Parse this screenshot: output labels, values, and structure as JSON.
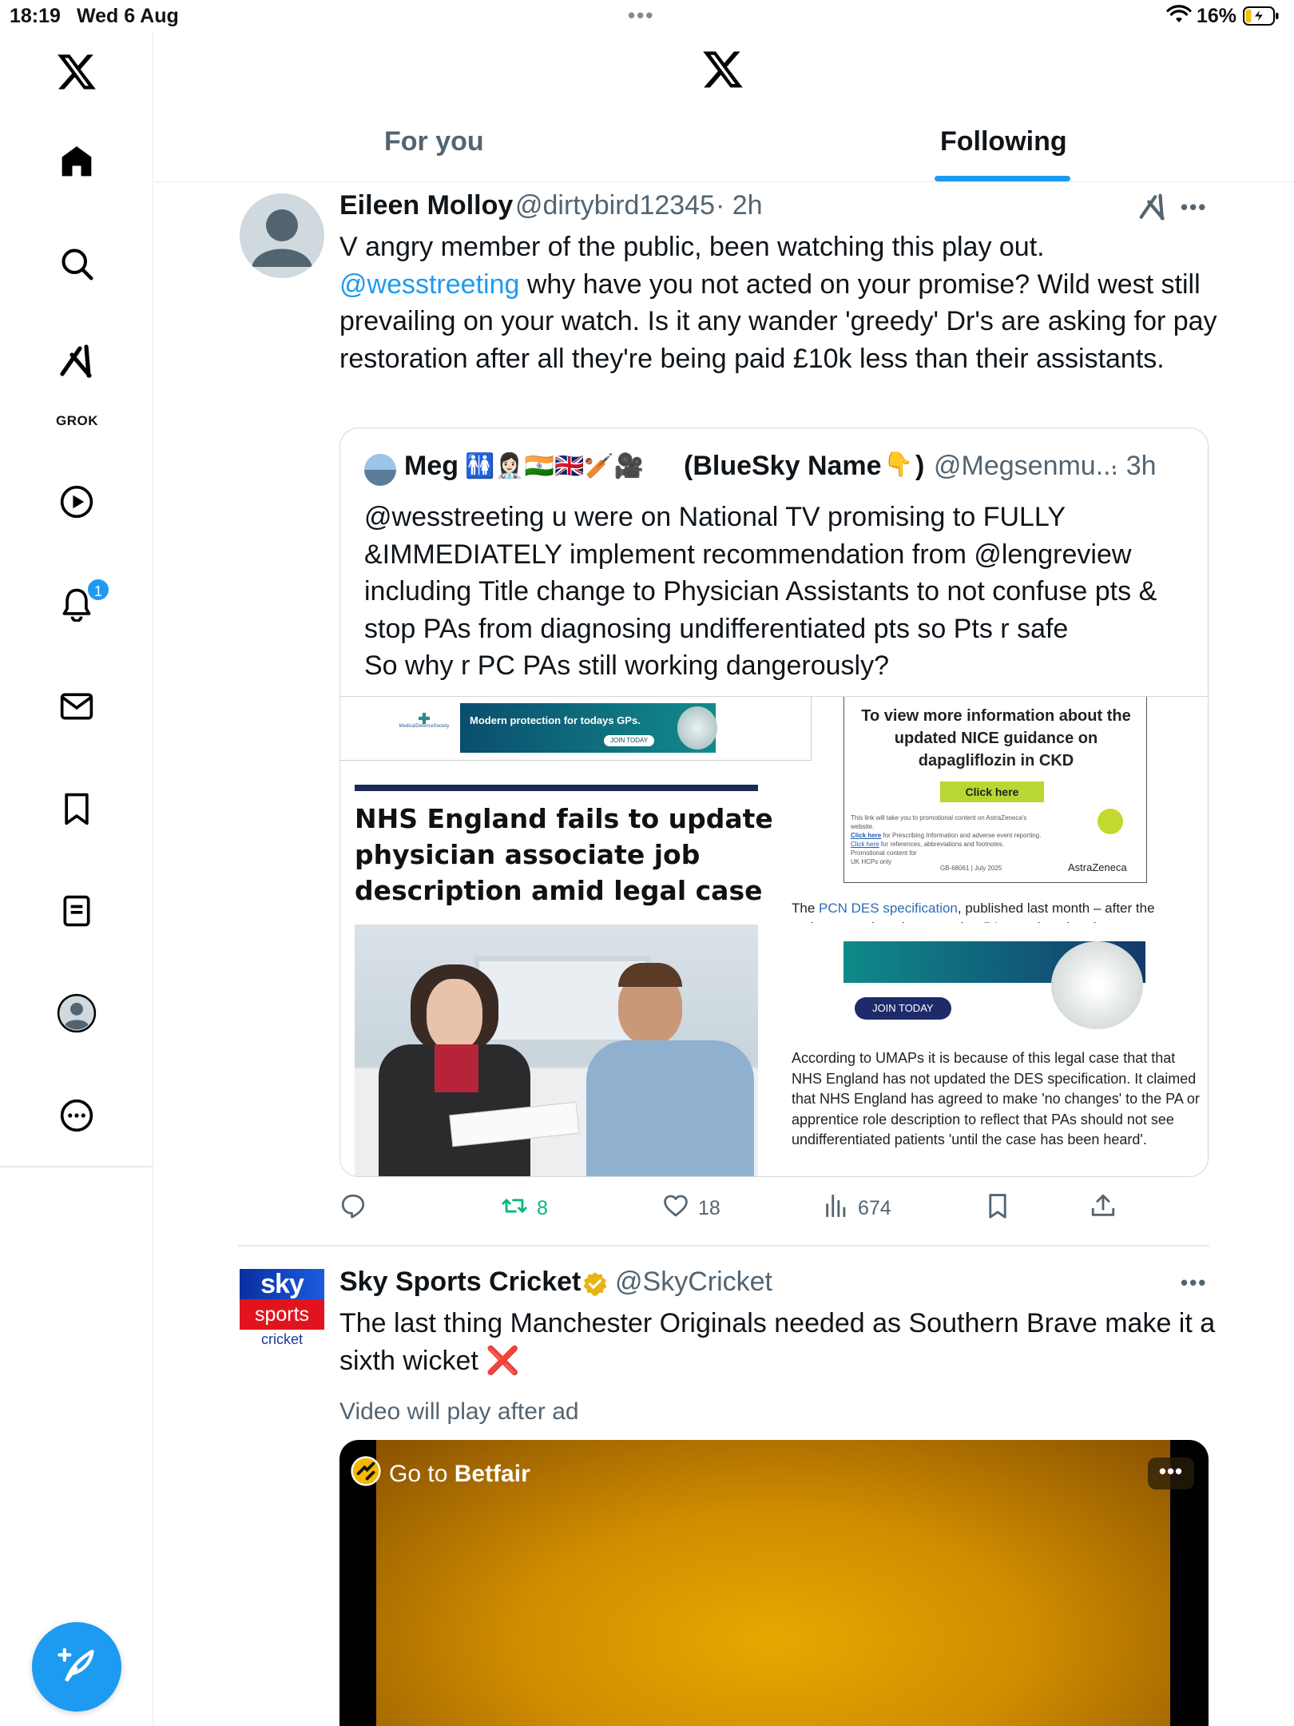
{
  "status_bar": {
    "time": "18:19",
    "date": "Wed 6 Aug",
    "battery": "16%"
  },
  "sidebar": {
    "grok_label": "GROK",
    "notification_count": "1"
  },
  "header": {
    "tabs": [
      {
        "label": "For you",
        "active": false
      },
      {
        "label": "Following",
        "active": true
      }
    ]
  },
  "tweet1": {
    "name": "Eileen Molloy",
    "handle": "@dirtybird12345",
    "time": "· 2h",
    "text_line1": "V angry member of the public, been watching this play out.",
    "mention": "@wesstreeting",
    "text_rest": " why have you not acted on your promise? Wild west still prevailing on your watch. Is it any wander 'greedy' Dr's are asking for pay restoration after all they're being paid £10k less than their assistants.",
    "quote": {
      "name": "Meg",
      "emojis": "🚻👩🏻‍⚕️🇮🇳🇬🇧🏏🎥",
      "name_suffix": "(BlueSky Name",
      "name_end": ")",
      "handle": "@Megsenmu...",
      "time": "· 3h",
      "text": "@wesstreeting u were on National TV promising to FULLY &IMMEDIATELY implement recommendation from @lengreview including Title change to Physician Assistants to not confuse pts & stop PAs from diagnosing undifferentiated pts so Pts r safe\nSo why r PC PAs still working dangerously?",
      "image": {
        "ad_banner_text": "Modern protection for todays GPs.",
        "ad_banner_btn": "JOIN TODAY",
        "ad_logo": "MedicalDefenceSociety",
        "headline": "NHS England fails to update physician associate job description amid legal case",
        "az_title": "To view more information about the updated NICE guidance on dapagliflozin in CKD",
        "az_btn": "Click here",
        "az_fine1": "This link will take you to promotional content on AstraZeneca's website.",
        "az_fine2_link": "Click here",
        "az_fine2": " for Prescribing Information and adverse event reporting.",
        "az_fine3_link": "Click here",
        "az_fine3": " for references, abbreviations and footnotes.",
        "az_fine4": "Promotional content for UK HCPs only",
        "az_code": "GB-68061 | July 2025",
        "az_brand": "AstraZeneca",
        "article_p1_pre": "The ",
        "article_p1_link": "PCN DES specification",
        "article_p1_post": ", published last month – after the review – continued to state that PAs employed under",
        "join_btn": "JOIN TODAY",
        "article_p2": "According to UMAPs it is because of this legal case that that NHS England has not updated the DES specification. It claimed that NHS England has agreed to make 'no changes' to the PA or apprentice role description to reflect that PAs should not see undifferentiated patients 'until the case has been heard'."
      }
    },
    "actions": {
      "reposts": "8",
      "likes": "18",
      "views": "674"
    }
  },
  "tweet2": {
    "name": "Sky Sports Cricket",
    "handle": "@SkyCricket",
    "text": "The last thing Manchester Originals needed as Southern Brave make it a sixth wicket ❌",
    "avatar_line1": "sky",
    "avatar_line2": "sports",
    "avatar_line3": "cricket",
    "video_note": "Video will play after ad",
    "video_cta_pre": "Go to ",
    "video_cta_brand": "Betfair",
    "video_more": "•••"
  },
  "colors": {
    "accent": "#1d9bf0",
    "text": "#0f1419",
    "muted": "#536471",
    "repost": "#00ba7c"
  },
  "icons": [
    "x-logo-icon",
    "home-icon",
    "search-icon",
    "grok-icon",
    "video-icon",
    "bell-icon",
    "mail-icon",
    "bookmark-icon",
    "list-icon",
    "profile-icon",
    "more-circle-icon",
    "compose-icon",
    "reply-icon",
    "repost-icon",
    "like-icon",
    "views-icon",
    "share-icon",
    "verified-badge-icon"
  ]
}
